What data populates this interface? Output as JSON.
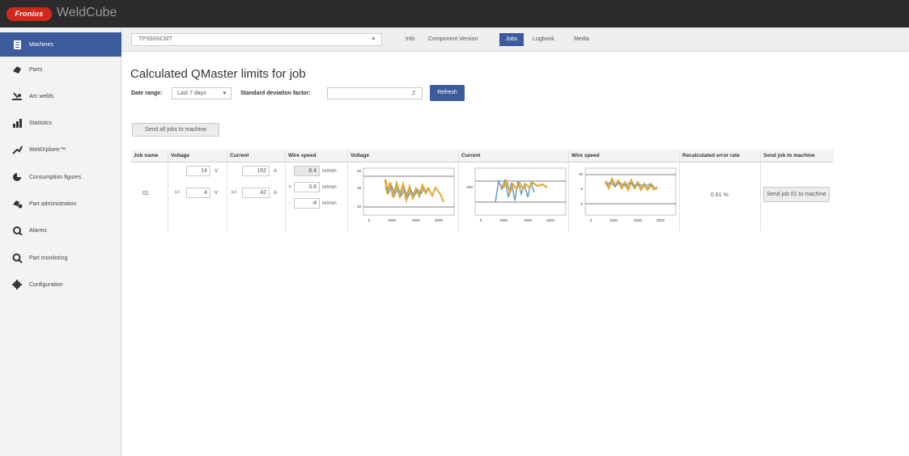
{
  "app": {
    "brand": "Fronius",
    "title": "WeldCube"
  },
  "sidebar": {
    "items": [
      {
        "label": "Machines",
        "icon": "list-icon",
        "active": true
      },
      {
        "label": "Parts",
        "icon": "part-icon"
      },
      {
        "label": "Arc welds",
        "icon": "arc-weld-icon"
      },
      {
        "label": "Statistics",
        "icon": "statistics-icon"
      },
      {
        "label": "WeldXplorer™",
        "icon": "explorer-icon"
      },
      {
        "label": "Consumption figures",
        "icon": "pie-icon"
      },
      {
        "label": "Part administration",
        "icon": "part-admin-icon"
      },
      {
        "label": "Alarms",
        "icon": "alarm-icon"
      },
      {
        "label": "Part monitoring",
        "icon": "monitor-icon"
      },
      {
        "label": "Configuration",
        "icon": "gear-icon"
      }
    ]
  },
  "header": {
    "machine_select": "TPS500iCMT",
    "tabs": [
      {
        "label": "Info"
      },
      {
        "label": "Component Version"
      },
      {
        "label": "Jobs",
        "active": true
      },
      {
        "label": "Logbook"
      },
      {
        "label": "Media"
      }
    ]
  },
  "page": {
    "title": "Calculated QMaster limits for job",
    "date_range_label": "Date range:",
    "date_range_value": "Last 7 days",
    "std_dev_label": "Standard deviation factor:",
    "std_dev_value": "2",
    "refresh_label": "Refresh",
    "send_all_label": "Send all jobs to machine"
  },
  "table": {
    "headers": [
      "Job name",
      "Voltage",
      "Current",
      "Wire speed",
      "Voltage",
      "Current",
      "Wire speed",
      "Recalculated error rate",
      "Send job to machine"
    ],
    "row": {
      "job_name": "01",
      "voltage": {
        "value": "14",
        "tolerance": "4",
        "unit": "V",
        "op": "+/-"
      },
      "current": {
        "value": "162",
        "tolerance": "42",
        "unit": "A",
        "op": "+/-"
      },
      "wire_speed": {
        "value": "8.4",
        "plus": "3.6",
        "minus": "-4",
        "unit": "m/min",
        "plus_op": "+",
        "minus_op": "-"
      },
      "error_rate": "0.81 %",
      "send_button": "Send job 01 to machine"
    }
  },
  "charts": {
    "colors": {
      "series_a": "#e0a83a",
      "series_b": "#6f9fc9",
      "limit_line": "#555555"
    },
    "x_ticks": [
      "0",
      "1000",
      "2000",
      "3000"
    ],
    "voltage": {
      "y_ticks": [
        "20",
        "15",
        "10"
      ]
    },
    "current": {
      "y_ticks": [
        "150"
      ]
    },
    "wire_speed": {
      "y_ticks": [
        "10",
        "5",
        "0"
      ]
    }
  }
}
